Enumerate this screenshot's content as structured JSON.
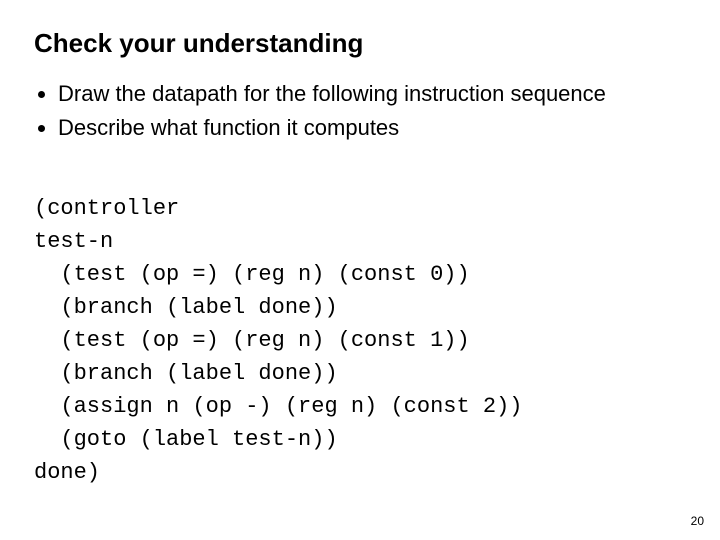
{
  "title": "Check your understanding",
  "bullets": [
    "Draw the datapath for the following instruction sequence",
    "Describe what function it computes"
  ],
  "code_lines": [
    "(controller",
    "test-n",
    "  (test (op =) (reg n) (const 0))",
    "  (branch (label done))",
    "  (test (op =) (reg n) (const 1))",
    "  (branch (label done))",
    "  (assign n (op -) (reg n) (const 2))",
    "  (goto (label test-n))",
    "done)"
  ],
  "page_number": "20"
}
